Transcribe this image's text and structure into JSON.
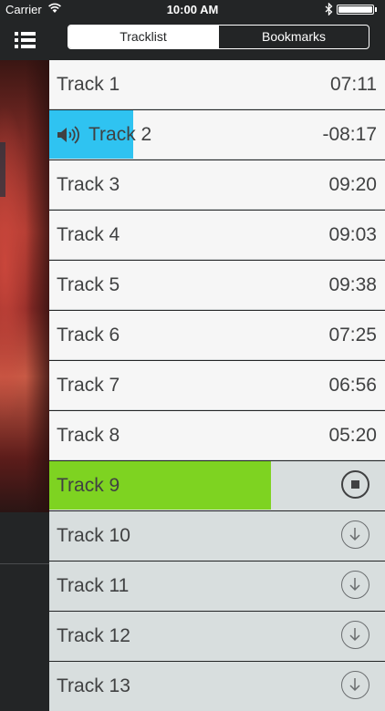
{
  "status_bar": {
    "carrier": "Carrier",
    "time": "10:00 AM",
    "icons": [
      "wifi-icon",
      "bluetooth-icon",
      "battery-icon"
    ]
  },
  "sidebar": {
    "menu_icon": "list-menu-icon",
    "album_art": "album-artwork"
  },
  "tabs": [
    {
      "label": "Tracklist",
      "selected": true
    },
    {
      "label": "Bookmarks",
      "selected": false
    }
  ],
  "colors": {
    "playing_progress": "#2fc3f1",
    "downloading_progress": "#7ed321",
    "row_background": "#f6f6f6",
    "undownloaded_row_background": "#d8dede",
    "dark_background": "#232526",
    "text": "#404142"
  },
  "tracks": [
    {
      "name": "Track 1",
      "duration": "07:11",
      "state": "downloaded"
    },
    {
      "name": "Track 2",
      "duration": "-08:17",
      "state": "playing",
      "progress": 0.25,
      "icon": "speaker-icon"
    },
    {
      "name": "Track 3",
      "duration": "09:20",
      "state": "downloaded"
    },
    {
      "name": "Track 4",
      "duration": "09:03",
      "state": "downloaded"
    },
    {
      "name": "Track 5",
      "duration": "09:38",
      "state": "downloaded"
    },
    {
      "name": "Track 6",
      "duration": "07:25",
      "state": "downloaded"
    },
    {
      "name": "Track 7",
      "duration": "06:56",
      "state": "downloaded"
    },
    {
      "name": "Track 8",
      "duration": "05:20",
      "state": "downloaded"
    },
    {
      "name": "Track 9",
      "state": "downloading",
      "progress": 0.66,
      "icon": "stop-download-icon"
    },
    {
      "name": "Track 10",
      "state": "not-downloaded",
      "icon": "download-icon"
    },
    {
      "name": "Track 11",
      "state": "not-downloaded",
      "icon": "download-icon"
    },
    {
      "name": "Track 12",
      "state": "not-downloaded",
      "icon": "download-icon"
    },
    {
      "name": "Track 13",
      "state": "not-downloaded",
      "icon": "download-icon"
    }
  ]
}
